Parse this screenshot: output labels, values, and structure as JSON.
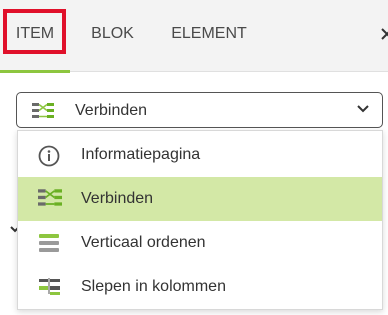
{
  "tabs": [
    {
      "label": "ITEM",
      "active": true
    },
    {
      "label": "BLOK",
      "active": false
    },
    {
      "label": "ELEMENT",
      "active": false
    }
  ],
  "select": {
    "value": "Verbinden",
    "icon": "connect-icon"
  },
  "options": [
    {
      "label": "Informatiepagina",
      "icon": "info-circle-icon",
      "selected": false
    },
    {
      "label": "Verbinden",
      "icon": "connect-icon",
      "selected": true
    },
    {
      "label": "Verticaal ordenen",
      "icon": "vertical-order-icon",
      "selected": false
    },
    {
      "label": "Slepen in kolommen",
      "icon": "drag-columns-icon",
      "selected": false
    }
  ],
  "colors": {
    "accent": "#8dc63f",
    "highlight": "#e0102a",
    "selected_bg": "#d3e8a6"
  }
}
